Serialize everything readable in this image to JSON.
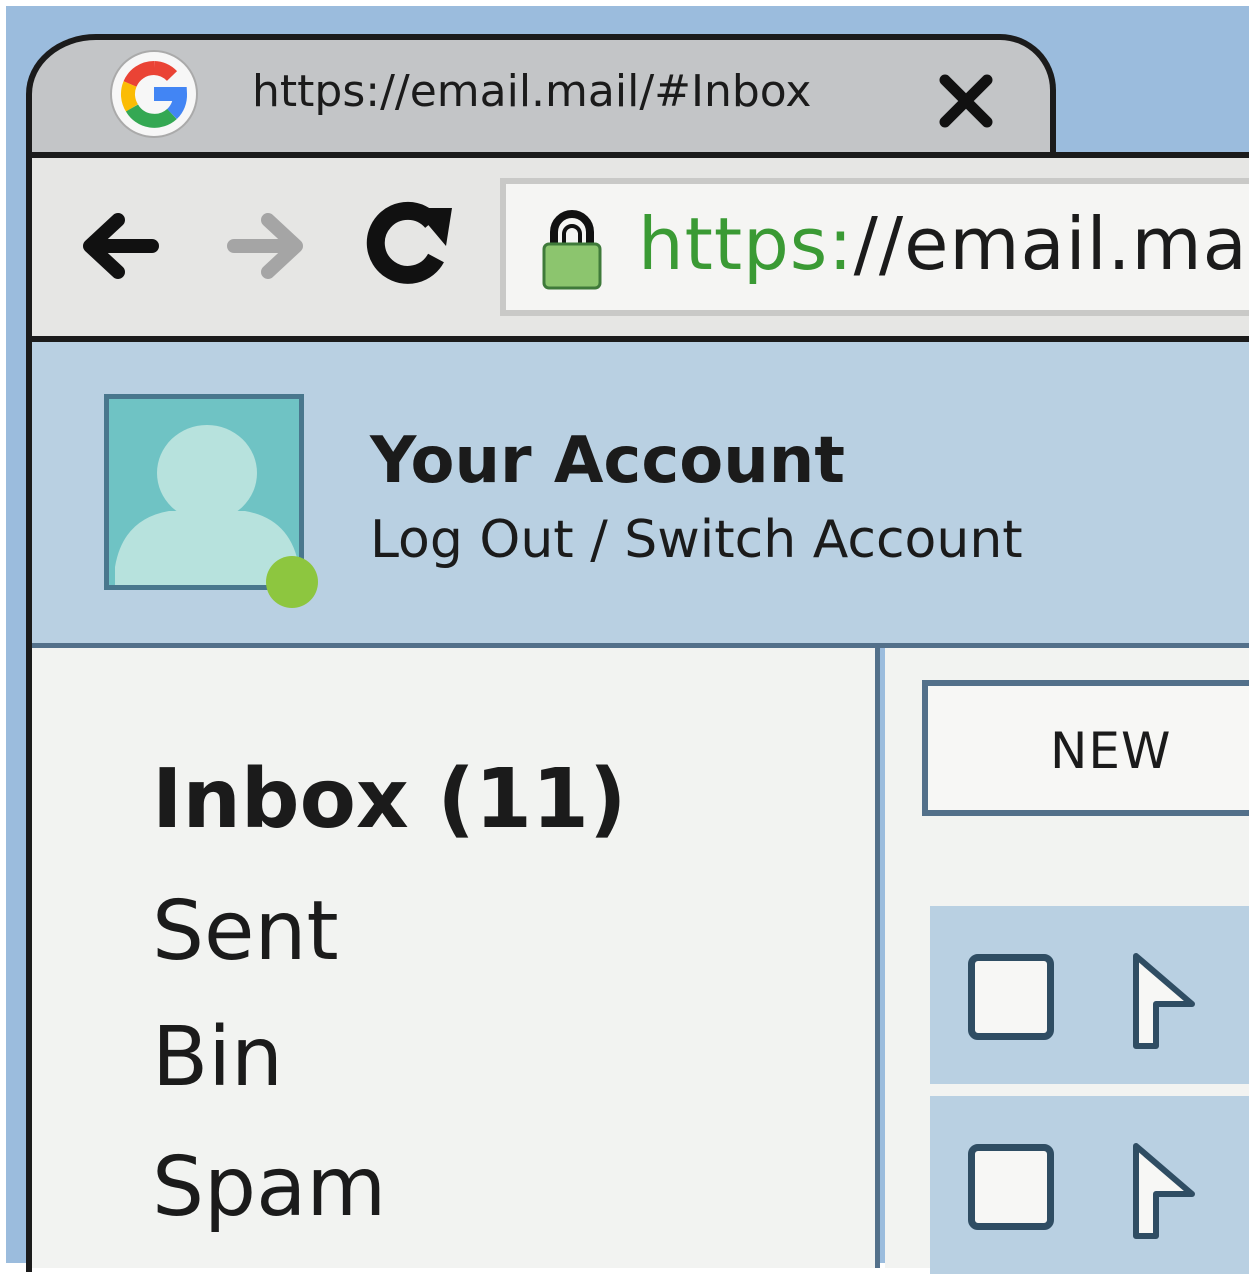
{
  "tab": {
    "title": "https://email.mail/#Inbox",
    "favicon": "google-g-icon",
    "close_icon": "close-icon"
  },
  "toolbar": {
    "back_icon": "back-arrow-icon",
    "forward_icon": "forward-arrow-icon",
    "reload_icon": "reload-icon",
    "lock_icon": "lock-icon",
    "url_scheme": "https:",
    "url_rest": "//email.mai"
  },
  "account": {
    "name": "Your Account",
    "logout": "Log Out",
    "separator": " / ",
    "switch": "Switch Account",
    "status": "online"
  },
  "sidebar": {
    "items": [
      {
        "label": "Inbox (11)",
        "active": true
      },
      {
        "label": "Sent"
      },
      {
        "label": "Bin"
      },
      {
        "label": "Spam"
      }
    ]
  },
  "main": {
    "new_label": "NEW"
  },
  "colors": {
    "background": "#9bbcdd",
    "header": "#b9d0e2",
    "url_green": "#3a9a34",
    "status_green": "#8dc63f",
    "avatar": "#6fc3c4"
  }
}
